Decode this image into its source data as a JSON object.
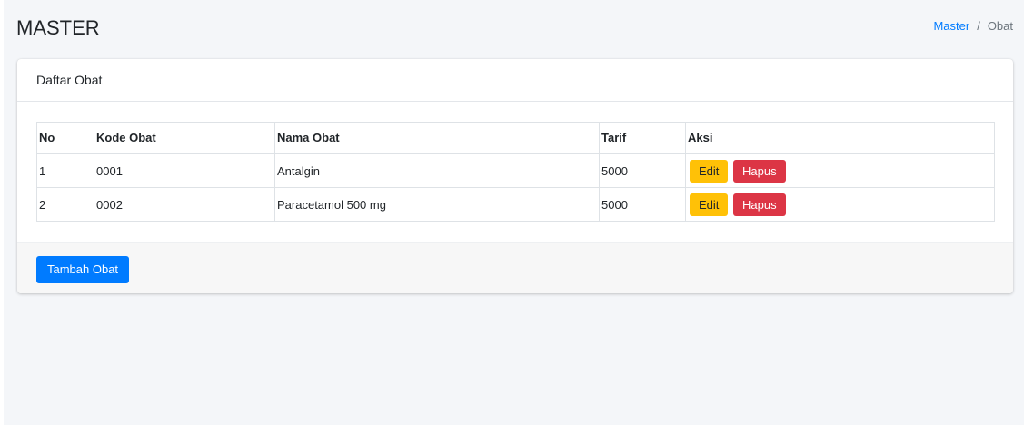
{
  "header": {
    "title": "MASTER",
    "breadcrumb": {
      "link": "Master",
      "separator": "/",
      "current": "Obat"
    }
  },
  "card": {
    "title": "Daftar Obat",
    "table": {
      "columns": [
        "No",
        "Kode Obat",
        "Nama Obat",
        "Tarif",
        "Aksi"
      ],
      "rows": [
        {
          "no": "1",
          "kode": "0001",
          "nama": "Antalgin",
          "tarif": "5000"
        },
        {
          "no": "2",
          "kode": "0002",
          "nama": "Paracetamol 500 mg",
          "tarif": "5000"
        }
      ],
      "edit_label": "Edit",
      "delete_label": "Hapus"
    },
    "add_button_label": "Tambah Obat"
  },
  "colors": {
    "primary": "#007bff",
    "warning": "#ffc107",
    "danger": "#dc3545",
    "background": "#f4f6f9"
  }
}
